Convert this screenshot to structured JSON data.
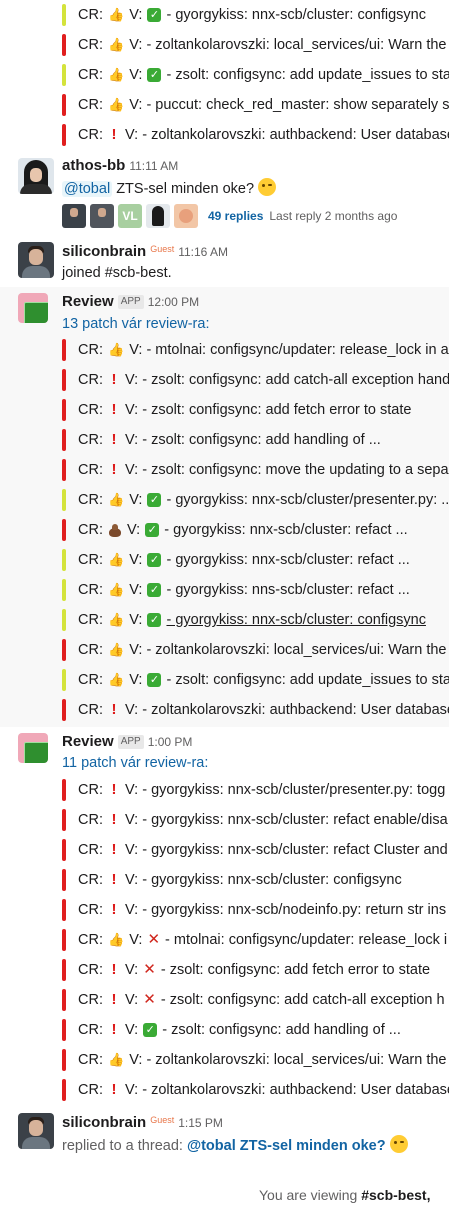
{
  "top_items": [
    {
      "label": "CR:",
      "cr": "thumb",
      "v": "check",
      "text": "- gyorgykiss: nnx-scb/cluster: configsync",
      "bar": "yellow"
    },
    {
      "label": "CR:",
      "cr": "thumb",
      "v": "none",
      "text": "- zoltankolarovszki: local_services/ui: Warn the",
      "bar": "red"
    },
    {
      "label": "CR:",
      "cr": "thumb",
      "v": "check",
      "text": "- zsolt: configsync: add update_issues to stat",
      "bar": "yellow"
    },
    {
      "label": "CR:",
      "cr": "thumb",
      "v": "none",
      "text": "- puccut: check_red_master: show separately se",
      "bar": "red"
    },
    {
      "label": "CR:",
      "cr": "excl",
      "v": "none",
      "text": "- zoltankolarovszki: authbackend: User database",
      "bar": "red"
    }
  ],
  "athos": {
    "name": "athos-bb",
    "time": "11:11 AM",
    "mention": "@tobal",
    "text": " ZTS-sel minden oke?",
    "thread": {
      "initials": "VL",
      "replies": "49 replies",
      "last": "Last reply 2 months ago"
    }
  },
  "silicon1": {
    "name": "siliconbrain",
    "guest": "Guest",
    "time": "11:16 AM",
    "text": "joined #scb-best."
  },
  "review1": {
    "name": "Review",
    "badge": "APP",
    "time": "12:00 PM",
    "summary": "13 patch vár review-ra:",
    "items": [
      {
        "label": "CR:",
        "cr": "thumb",
        "v": "none",
        "text": "- mtolnai: configsync/updater: release_lock in a",
        "bar": "red"
      },
      {
        "label": "CR:",
        "cr": "excl",
        "v": "none",
        "text": "- zsolt: configsync: add catch-all exception hand",
        "bar": "red"
      },
      {
        "label": "CR:",
        "cr": "excl",
        "v": "none",
        "text": "- zsolt: configsync: add fetch error to state",
        "bar": "red"
      },
      {
        "label": "CR:",
        "cr": "excl",
        "v": "none",
        "text": "- zsolt: configsync: add handling of ...",
        "bar": "red"
      },
      {
        "label": "CR:",
        "cr": "excl",
        "v": "none",
        "text": "- zsolt: configsync: move the updating to a sepa",
        "bar": "red"
      },
      {
        "label": "CR:",
        "cr": "thumb",
        "v": "check",
        "text": "- gyorgykiss: nnx-scb/cluster/presenter.py: ...",
        "bar": "yellow"
      },
      {
        "label": "CR:",
        "cr": "poop",
        "v": "check",
        "text": "- gyorgykiss: nnx-scb/cluster: refact ...",
        "bar": "red"
      },
      {
        "label": "CR:",
        "cr": "thumb",
        "v": "check",
        "text": "- gyorgykiss: nnx-scb/cluster: refact ...",
        "bar": "yellow"
      },
      {
        "label": "CR:",
        "cr": "thumb",
        "v": "check",
        "text": "- gyorgykiss: nns-scb/cluster: refact ...",
        "bar": "yellow"
      },
      {
        "label": "CR:",
        "cr": "thumb",
        "v": "check",
        "text": "- gyorgykiss: nnx-scb/cluster: configsync",
        "bar": "yellow",
        "underline": true
      },
      {
        "label": "CR:",
        "cr": "thumb",
        "v": "none",
        "text": "- zoltankolarovszki: local_services/ui: Warn the",
        "bar": "red"
      },
      {
        "label": "CR:",
        "cr": "thumb",
        "v": "check",
        "text": "- zsolt: configsync: add update_issues to stat",
        "bar": "yellow"
      },
      {
        "label": "CR:",
        "cr": "excl",
        "v": "none",
        "text": "- zoltankolarovszki: authbackend: User database",
        "bar": "red"
      }
    ]
  },
  "review2": {
    "name": "Review",
    "badge": "APP",
    "time": "1:00 PM",
    "summary": "11 patch vár review-ra:",
    "items": [
      {
        "label": "CR:",
        "cr": "excl",
        "v": "none",
        "text": "- gyorgykiss: nnx-scb/cluster/presenter.py: togg",
        "bar": "red"
      },
      {
        "label": "CR:",
        "cr": "excl",
        "v": "none",
        "text": "- gyorgykiss: nnx-scb/cluster: refact enable/disa",
        "bar": "red"
      },
      {
        "label": "CR:",
        "cr": "excl",
        "v": "none",
        "text": "- gyorgykiss: nnx-scb/cluster: refact Cluster and",
        "bar": "red"
      },
      {
        "label": "CR:",
        "cr": "excl",
        "v": "none",
        "text": "- gyorgykiss: nnx-scb/cluster: configsync",
        "bar": "red"
      },
      {
        "label": "CR:",
        "cr": "excl",
        "v": "none",
        "text": "- gyorgykiss: nnx-scb/nodeinfo.py: return str ins",
        "bar": "red"
      },
      {
        "label": "CR:",
        "cr": "thumb",
        "v": "cross",
        "text": "- mtolnai: configsync/updater: release_lock i",
        "bar": "red"
      },
      {
        "label": "CR:",
        "cr": "excl",
        "v": "cross",
        "text": "- zsolt: configsync: add fetch error to state",
        "bar": "red"
      },
      {
        "label": "CR:",
        "cr": "excl",
        "v": "cross",
        "text": "- zsolt: configsync: add catch-all exception h",
        "bar": "red"
      },
      {
        "label": "CR:",
        "cr": "excl",
        "v": "check",
        "text": "- zsolt: configsync: add handling of ...",
        "bar": "red"
      },
      {
        "label": "CR:",
        "cr": "thumb",
        "v": "none",
        "text": "- zoltankolarovszki: local_services/ui: Warn the",
        "bar": "red"
      },
      {
        "label": "CR:",
        "cr": "excl",
        "v": "none",
        "text": "- zoltankolarovszki: authbackend: User database",
        "bar": "red"
      }
    ]
  },
  "silicon2": {
    "name": "siliconbrain",
    "guest": "Guest",
    "time": "1:15 PM",
    "prefix": "replied to a thread:",
    "link": "@tobal ZTS-sel minden oke?"
  },
  "footer": {
    "text": "You are viewing ",
    "channel": "#scb-best,"
  },
  "colors": {
    "red_bar": "#e01e1e",
    "yellow_bar": "#d4e33b",
    "link": "#1264a3",
    "check": "#3aaa35"
  }
}
